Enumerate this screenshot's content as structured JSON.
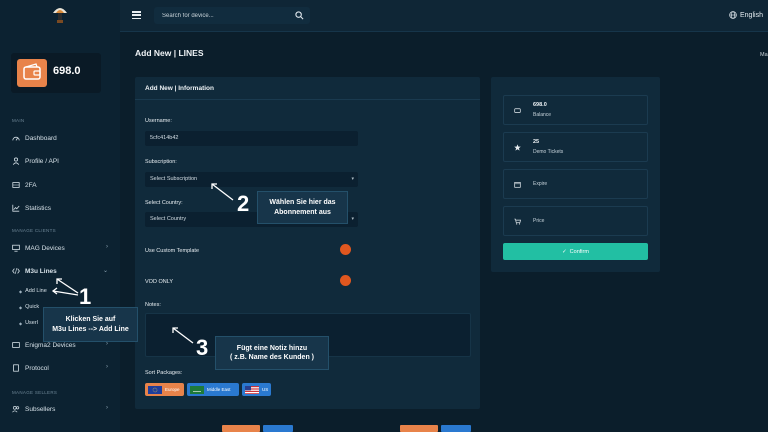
{
  "header": {
    "search_placeholder": "Search for device...",
    "language": "English"
  },
  "sidebar": {
    "balance": "698.0",
    "sections": {
      "main": "MAIN",
      "manage_clients": "MANAGE CLIENTS",
      "manage_sellers": "MANAGE SELLERS"
    },
    "items": {
      "dashboard": "Dashboard",
      "profile": "Profile / API",
      "twofa": "2FA",
      "statistics": "Statistics",
      "mag": "MAG Devices",
      "m3u": "M3u Lines",
      "add_line": "Add Line",
      "quick": "Quick",
      "userl": "Userl",
      "enigma": "Enigma2 Devices",
      "protocol": "Protocol",
      "subsellers": "Subsellers"
    }
  },
  "main": {
    "page_title": "Add New | LINES",
    "edge_text": "Ma",
    "panel_title": "Add New | Information",
    "username_label": "Username:",
    "username_value": "5cfc414b42",
    "subscription_label": "Subscription:",
    "subscription_value": "Select Subscription",
    "country_label": "Select Country:",
    "country_value": "Select Country",
    "custom_template_label": "Use Custom Template",
    "vod_only_label": "VOD ONLY",
    "notes_label": "Notes:",
    "sort_packages_label": "Sort Packages:",
    "packages": [
      "Europe",
      "Middle East",
      "US"
    ]
  },
  "summary": {
    "balance_value": "698.0",
    "balance_label": "Balance",
    "demo_value": "25",
    "demo_label": "Demo Tickets",
    "expire_label": "Expire",
    "price_label": "Price",
    "confirm_label": "Confirm"
  },
  "annotations": {
    "one": "1",
    "two": "2",
    "three": "3",
    "callout1_line1": "Klicken Sie auf",
    "callout1_line2": "M3u Lines --> Add Line",
    "callout2_line1": "Wählen Sie hier das",
    "callout2_line2": "Abonnement aus",
    "callout3_line1": "Fügt eine Notiz hinzu",
    "callout3_line2": "( z.B. Name des Kunden )"
  },
  "colors": {
    "accent_confirm": "#22bfa3",
    "toggle": "#e0571f",
    "wallet": "#e8834a",
    "pkg_europe": "#e8834a",
    "pkg_middle_east": "#2a79d0",
    "pkg_us": "#2a79d0"
  }
}
